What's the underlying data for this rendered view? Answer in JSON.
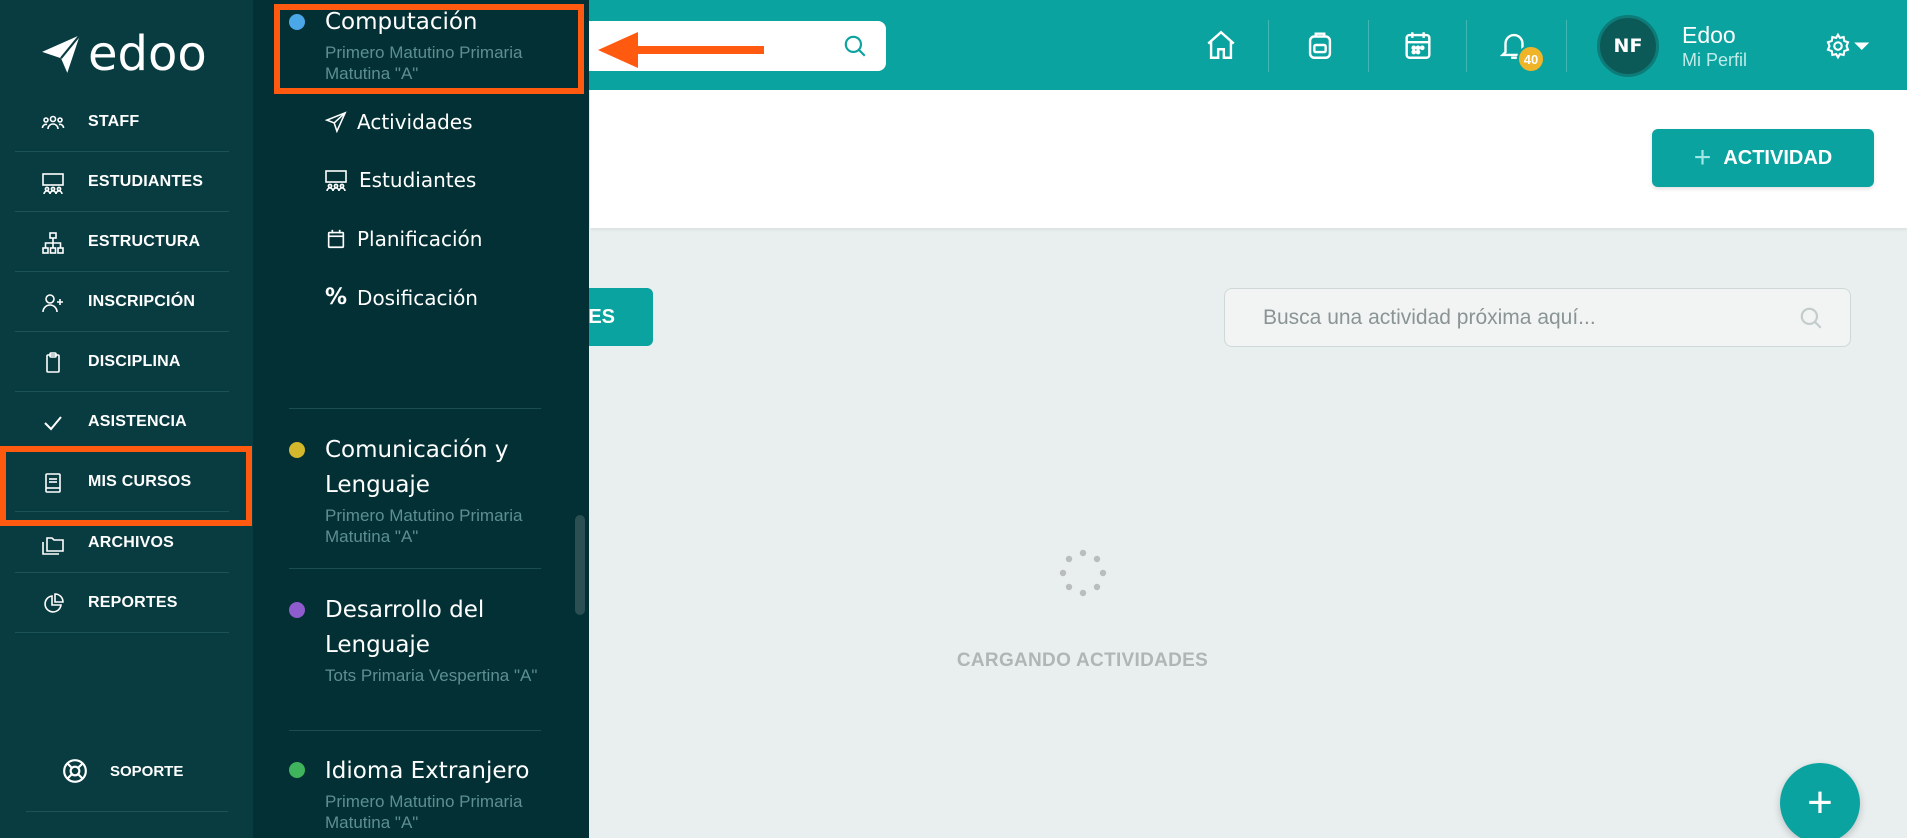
{
  "app": {
    "logo_text": "edoo"
  },
  "sidebar": {
    "items": [
      {
        "label": "STAFF",
        "icon": "staff-icon"
      },
      {
        "label": "ESTUDIANTES",
        "icon": "students-icon"
      },
      {
        "label": "ESTRUCTURA",
        "icon": "structure-icon"
      },
      {
        "label": "INSCRIPCIÓN",
        "icon": "add-user-icon"
      },
      {
        "label": "DISCIPLINA",
        "icon": "clipboard-icon"
      },
      {
        "label": "ASISTENCIA",
        "icon": "check-icon"
      },
      {
        "label": "MIS CURSOS",
        "icon": "book-icon"
      },
      {
        "label": "ARCHIVOS",
        "icon": "folders-icon"
      },
      {
        "label": "REPORTES",
        "icon": "pie-chart-icon"
      }
    ],
    "support_label": "SOPORTE"
  },
  "course_panel": {
    "active_course": {
      "title": "Computación",
      "subtitle": "Primero Matutino Primaria Matutina \"A\"",
      "color": "#4aa8e8"
    },
    "sub_items": [
      {
        "label": "Actividades",
        "icon": "paper-plane-icon"
      },
      {
        "label": "Estudiantes",
        "icon": "students-icon"
      },
      {
        "label": "Planificación",
        "icon": "calendar-icon"
      },
      {
        "label": "Dosificación",
        "icon": "percent-icon"
      }
    ],
    "courses": [
      {
        "title": "Comunicación y Lenguaje",
        "subtitle": "Primero Matutino Primaria Matutina \"A\"",
        "color": "#d4b82b"
      },
      {
        "title": "Desarrollo del Lenguaje",
        "subtitle": "Tots Primaria Vespertina \"A\"",
        "color": "#8e5ccc"
      },
      {
        "title": "Idioma Extranjero",
        "subtitle": "Primero Matutino Primaria Matutina \"A\"",
        "color": "#3fb45d"
      }
    ]
  },
  "topbar": {
    "notification_count": "40",
    "avatar_initials": "NF",
    "profile_name": "Edoo",
    "profile_link": "Mi Perfil"
  },
  "main": {
    "add_activity_label": "ACTIVIDAD",
    "partial_button_label": "ES",
    "search_placeholder": "Busca una actividad próxima aquí...",
    "loading_text": "CARGANDO ACTIVIDADES"
  },
  "colors": {
    "accent": "#0ba3a0",
    "sidebar": "#093c41",
    "panel": "#033034",
    "highlight": "#ff5a10",
    "badge": "#f0b429"
  }
}
